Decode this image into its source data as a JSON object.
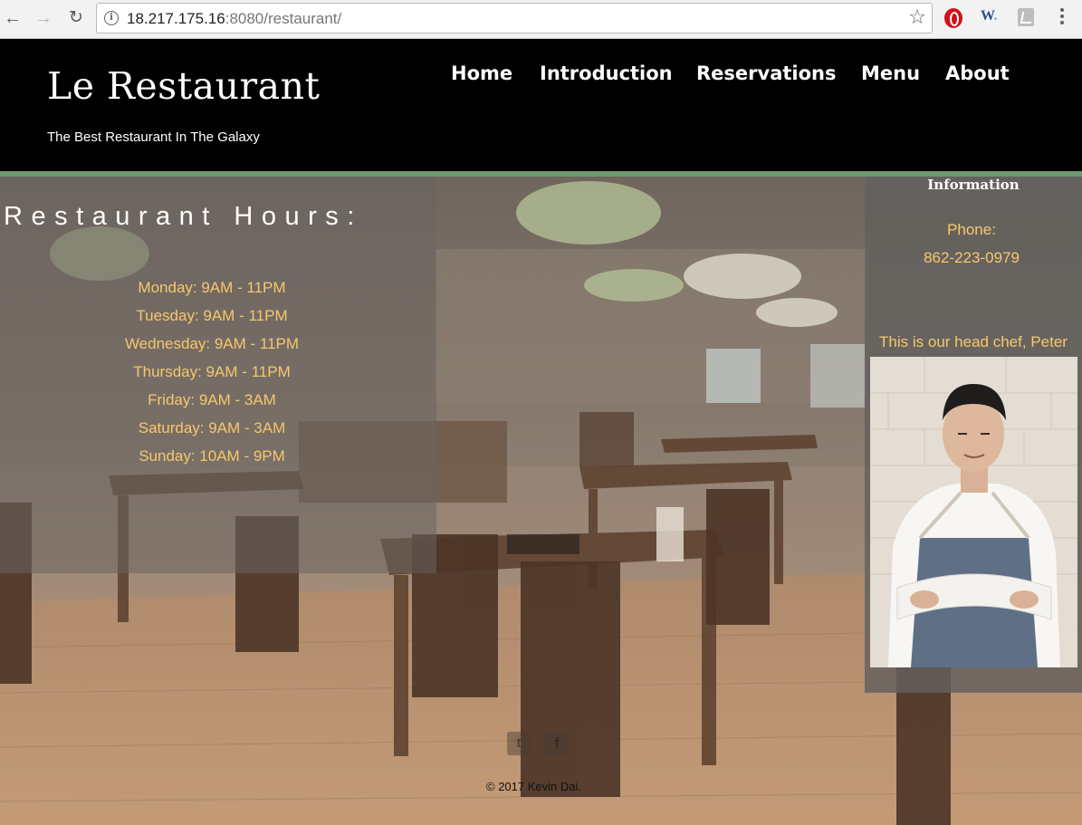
{
  "browser": {
    "url_host": "18.217.175.16",
    "url_rest": ":8080/restaurant/"
  },
  "site": {
    "title": "Le Restaurant",
    "tagline": "The Best Restaurant In The Galaxy"
  },
  "nav": {
    "items": [
      {
        "label": "Home"
      },
      {
        "label": "Introduction"
      },
      {
        "label": "Reservations"
      },
      {
        "label": "Menu"
      },
      {
        "label": "About"
      }
    ]
  },
  "hours": {
    "title": "Restaurant Hours:",
    "days": [
      "Monday: 9AM - 11PM",
      "Tuesday: 9AM - 11PM",
      "Wednesday: 9AM - 11PM",
      "Thursday: 9AM - 11PM",
      "Friday: 9AM - 3AM",
      "Saturday: 9AM - 3AM",
      "Sunday: 10AM - 9PM"
    ]
  },
  "info": {
    "title": "Information",
    "phone_label": "Phone:",
    "phone": "862-223-0979",
    "chef_caption": "This is our head chef, Peter"
  },
  "footer": {
    "copyright": "© 2017 Kevin Dai."
  },
  "colors": {
    "header_bg": "#000000",
    "accent_green": "#6b9a6e",
    "hours_text": "#f7c76b"
  }
}
